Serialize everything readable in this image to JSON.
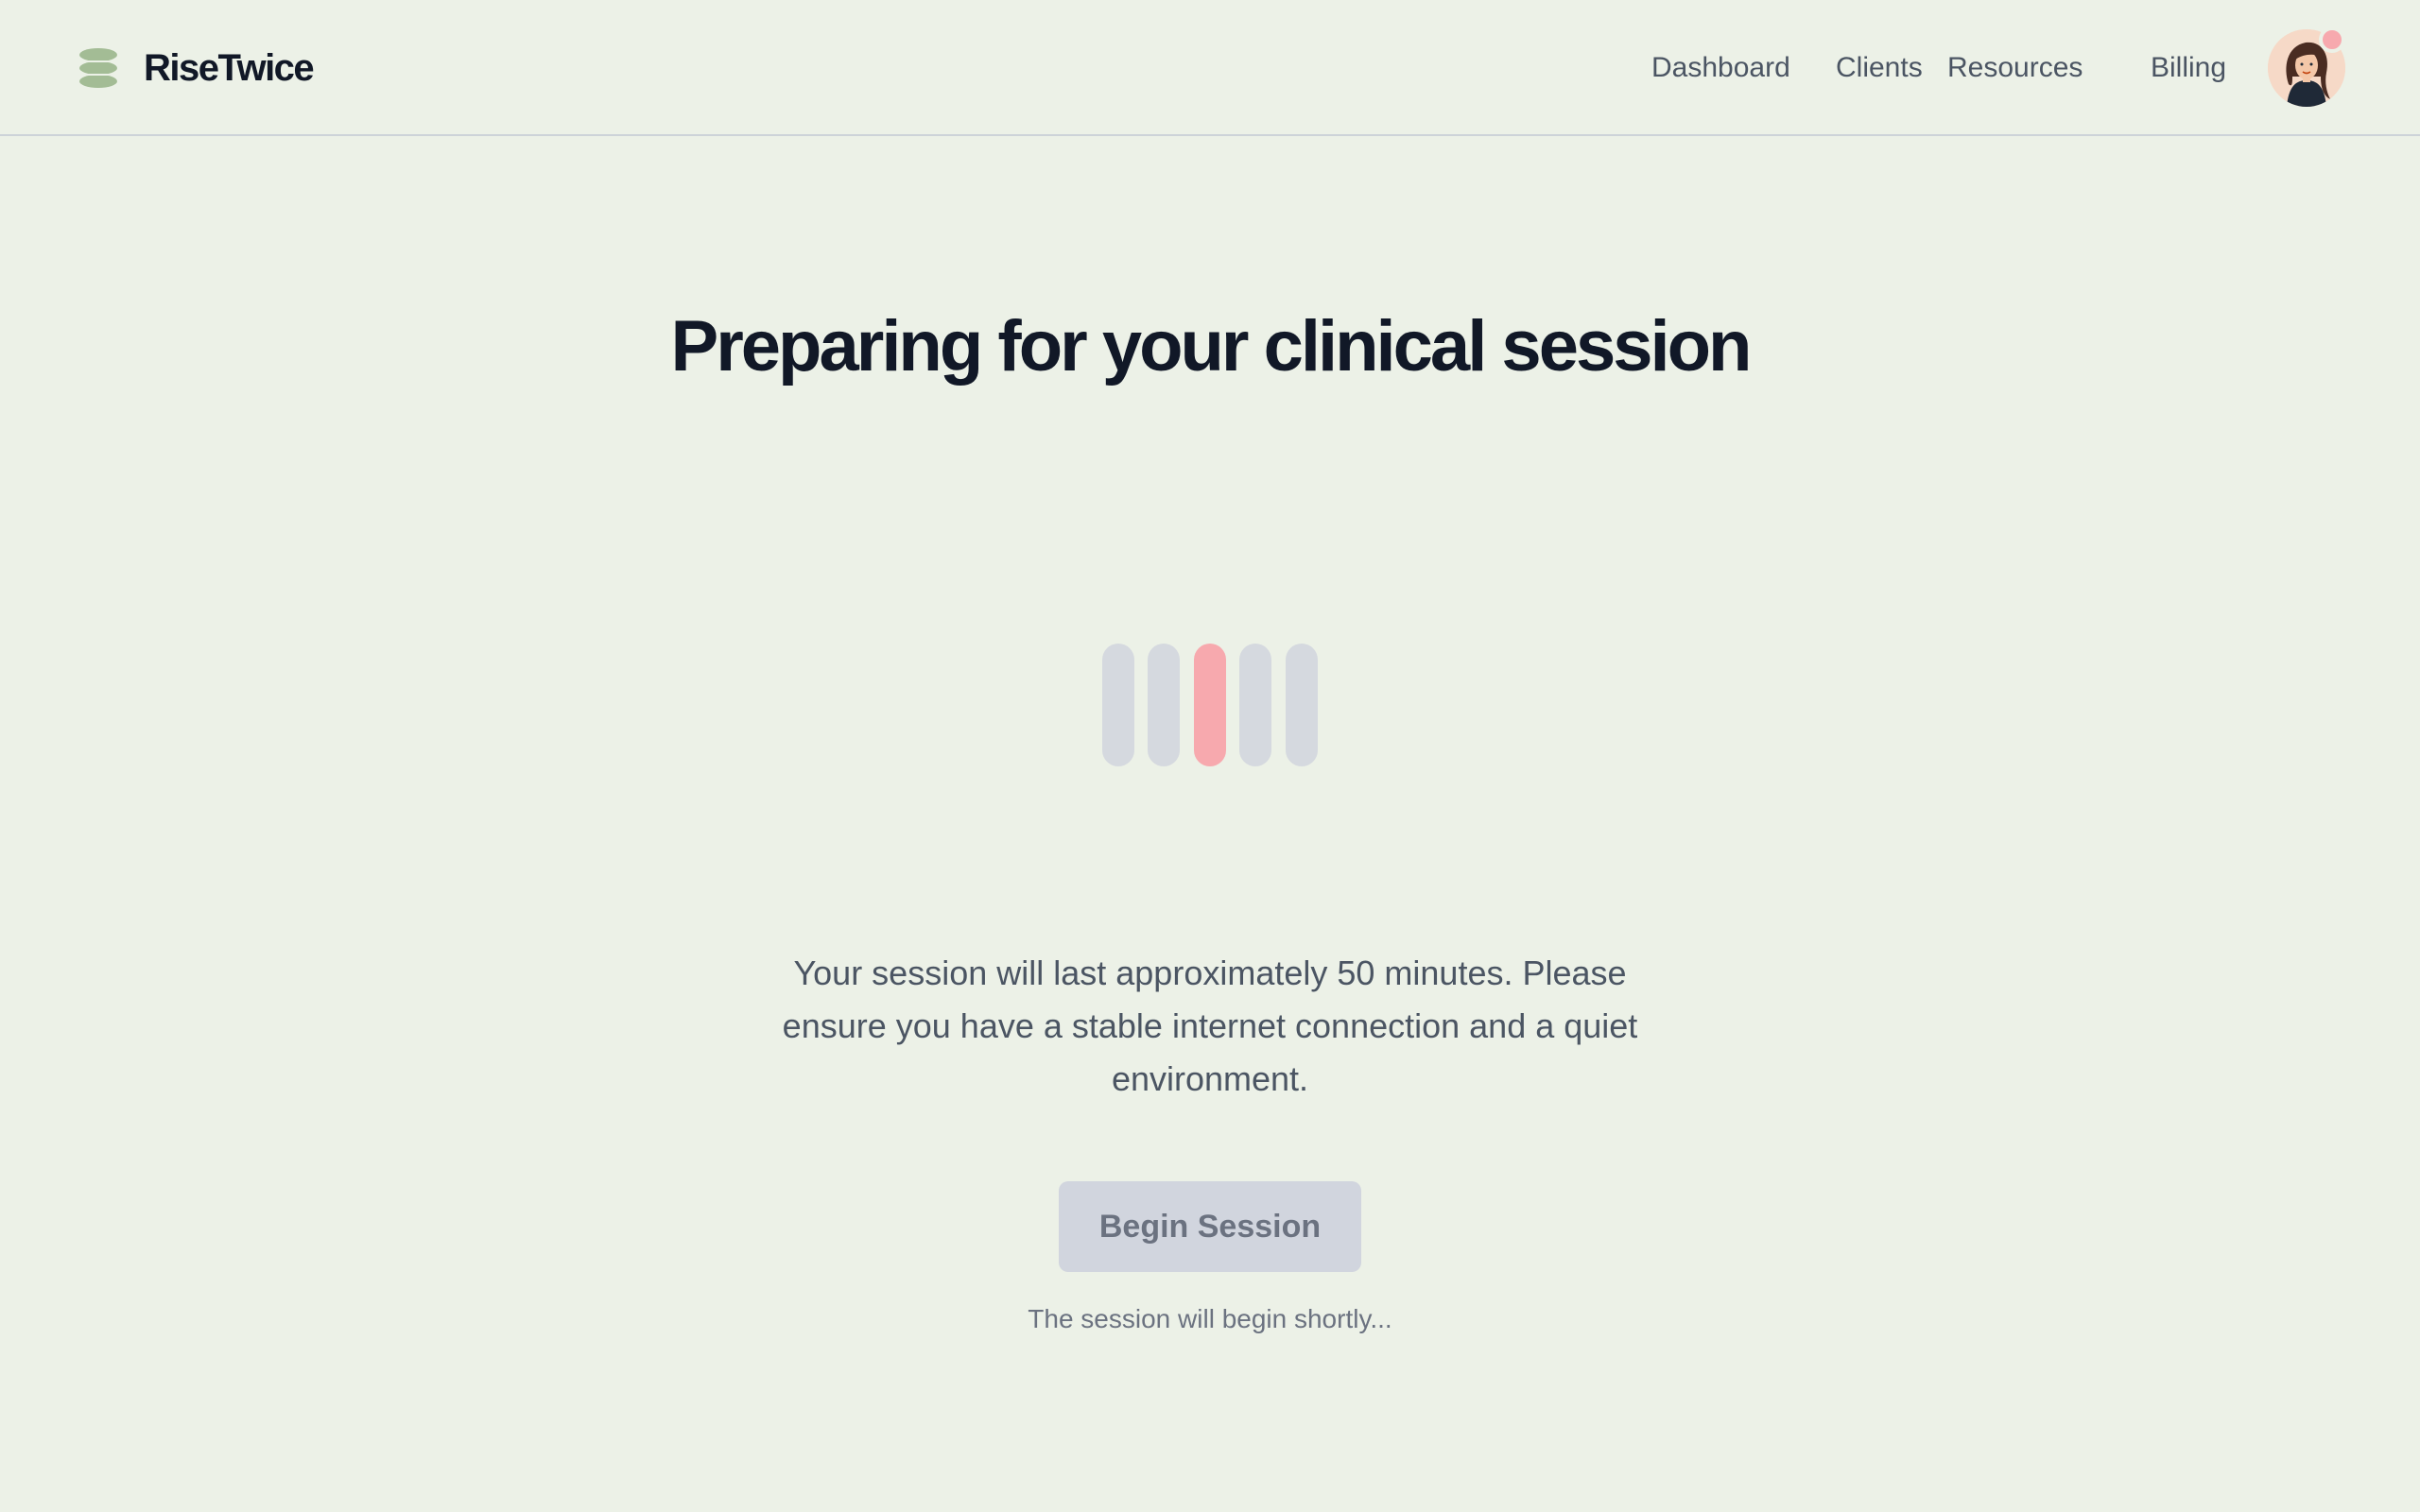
{
  "header": {
    "brand_name": "RiseTwice",
    "logo_icon": "stacked-layers-logo-icon",
    "nav": [
      {
        "label": "Dashboard"
      },
      {
        "label": "Clients"
      },
      {
        "label": "Resources"
      },
      {
        "label": "Billing"
      }
    ],
    "avatar": "user-avatar",
    "notification_badge_color": "#F7A9AE"
  },
  "main": {
    "title": "Preparing for your clinical session",
    "loader": {
      "bar_count": 5,
      "active_index": 2,
      "active_color": "#F7A9AE",
      "inactive_color": "#D5D9DF"
    },
    "description": "Your session will last approximately 50 minutes. Please ensure you have a stable internet connection and a quiet environment.",
    "begin_button_label": "Begin Session",
    "begin_button_disabled": true,
    "status_text": "The session will begin shortly..."
  },
  "colors": {
    "background": "#ECF1E7",
    "logo": "#A3BC95",
    "heading": "#111827",
    "body_text": "#4B5563",
    "muted_text": "#6B7280",
    "button_bg": "#D1D5DE"
  }
}
